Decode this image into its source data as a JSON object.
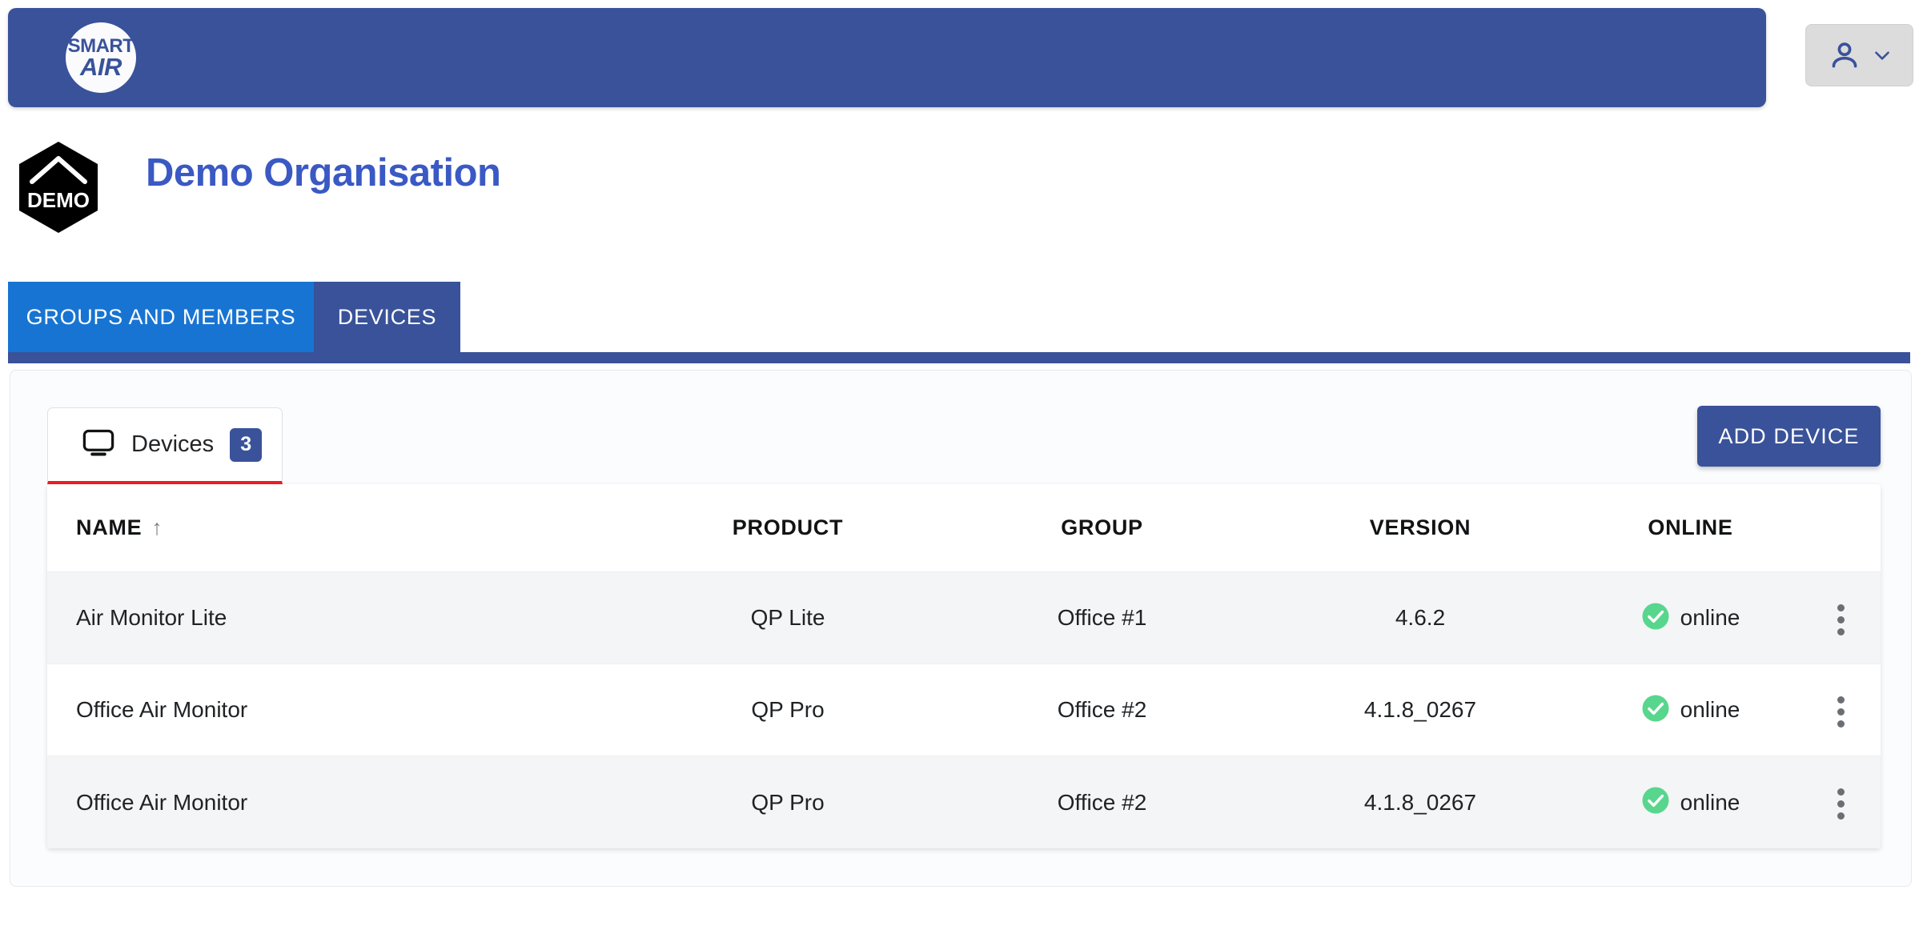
{
  "appbar": {
    "brand_line1": "SMART",
    "brand_line2": "AIR",
    "bg_color": "#39529a"
  },
  "account": {
    "icon": "person-icon",
    "chevron": "chevron-down-icon"
  },
  "organisation": {
    "badge_text": "DEMO",
    "title": "Demo Organisation",
    "title_color": "#3a59c4"
  },
  "tabs": [
    {
      "label": "GROUPS AND MEMBERS",
      "active": false,
      "color": "#1874d2"
    },
    {
      "label": "DEVICES",
      "active": true,
      "color": "#39529a"
    }
  ],
  "devices_panel": {
    "subtab": {
      "icon": "monitor-icon",
      "label": "Devices",
      "count": "3",
      "accent_color": "#ee1c25"
    },
    "add_device_label": "ADD DEVICE",
    "table": {
      "columns": [
        "NAME",
        "PRODUCT",
        "GROUP",
        "VERSION",
        "ONLINE"
      ],
      "sort_column": "NAME",
      "sort_direction": "↑",
      "rows": [
        {
          "name": "Air Monitor Lite",
          "product": "QP Lite",
          "group": "Office #1",
          "version": "4.6.2",
          "online": "online",
          "status_color": "#58d68d"
        },
        {
          "name": "Office Air Monitor",
          "product": "QP Pro",
          "group": "Office #2",
          "version": "4.1.8_0267",
          "online": "online",
          "status_color": "#58d68d"
        },
        {
          "name": "Office Air Monitor",
          "product": "QP Pro",
          "group": "Office #2",
          "version": "4.1.8_0267",
          "online": "online",
          "status_color": "#58d68d"
        }
      ]
    }
  }
}
